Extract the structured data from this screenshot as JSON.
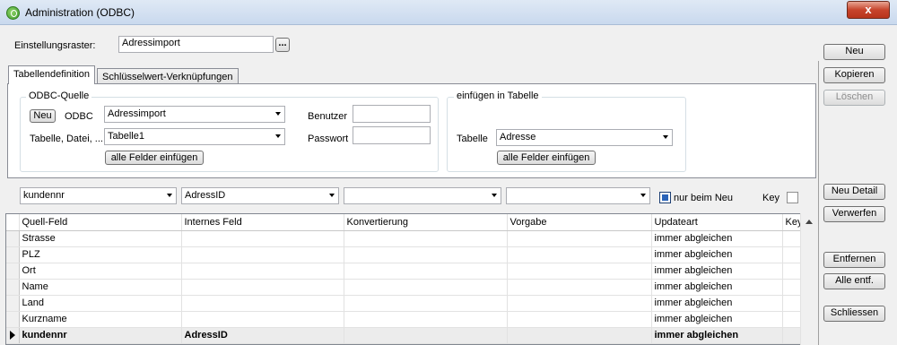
{
  "window": {
    "title": "Administration (ODBC)",
    "close_glyph": "x"
  },
  "settings": {
    "label": "Einstellungsraster:",
    "value": "Adressimport",
    "browse_label": "..."
  },
  "tabs": [
    {
      "label": "Tabellendefinition"
    },
    {
      "label": "Schlüsselwert-Verknüpfungen"
    }
  ],
  "odbc": {
    "group_title": "ODBC-Quelle",
    "new_button": "Neu",
    "odbc_label": "ODBC",
    "odbc_value": "Adressimport",
    "table_label": "Tabelle, Datei, ...",
    "table_value": "Tabelle1",
    "all_fields_button": "alle Felder einfügen",
    "user_label": "Benutzer",
    "user_value": "",
    "password_label": "Passwort",
    "password_value": ""
  },
  "insert": {
    "group_title": "einfügen in Tabelle",
    "table_label": "Tabelle",
    "table_value": "Adresse",
    "all_fields_button": "alle Felder einfügen"
  },
  "mapping": {
    "source_value": "kundennr",
    "internal_value": "AdressID",
    "conversion_value": "",
    "default_value": "",
    "only_new_label": "nur beim Neu",
    "only_new_checked": true,
    "key_label": "Key",
    "key_checked": false
  },
  "grid": {
    "columns": [
      "Quell-Feld",
      "Internes Feld",
      "Konvertierung",
      "Vorgabe",
      "Updateart",
      "Key"
    ],
    "rows": [
      {
        "source": "Strasse",
        "internal": "",
        "conversion": "",
        "default": "",
        "update": "immer abgleichen",
        "key": ""
      },
      {
        "source": "PLZ",
        "internal": "",
        "conversion": "",
        "default": "",
        "update": "immer abgleichen",
        "key": ""
      },
      {
        "source": "Ort",
        "internal": "",
        "conversion": "",
        "default": "",
        "update": "immer abgleichen",
        "key": ""
      },
      {
        "source": "Name",
        "internal": "",
        "conversion": "",
        "default": "",
        "update": "immer abgleichen",
        "key": ""
      },
      {
        "source": "Land",
        "internal": "",
        "conversion": "",
        "default": "",
        "update": "immer abgleichen",
        "key": ""
      },
      {
        "source": "Kurzname",
        "internal": "",
        "conversion": "",
        "default": "",
        "update": "immer abgleichen",
        "key": ""
      },
      {
        "source": "kundennr",
        "internal": "AdressID",
        "conversion": "",
        "default": "",
        "update": "immer abgleichen",
        "key": ""
      }
    ]
  },
  "side_buttons": {
    "new": "Neu",
    "copy": "Kopieren",
    "delete": "Löschen",
    "new_detail": "Neu Detail",
    "discard": "Verwerfen",
    "remove": "Entfernen",
    "remove_all": "Alle entf.",
    "close": "Schliessen"
  }
}
